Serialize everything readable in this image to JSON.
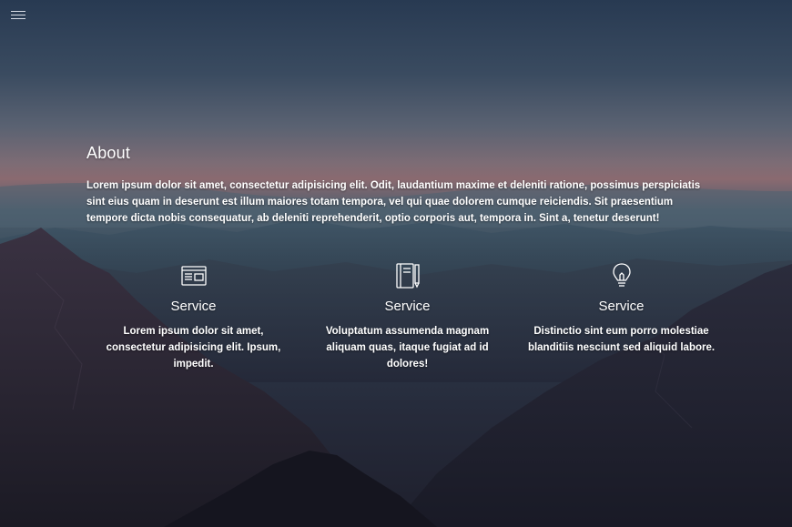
{
  "nav": {
    "menu_icon": "hamburger-menu-icon"
  },
  "about": {
    "title": "About",
    "text": "Lorem ipsum dolor sit amet, consectetur adipisicing elit. Odit, laudantium maxime et deleniti ratione, possimus perspiciatis sint eius quam in deserunt est illum maiores totam tempora, vel qui quae dolorem cumque reiciendis. Sit praesentium tempore dicta nobis consequatur, ab deleniti reprehenderit, optio corporis aut, tempora in. Sint a, tenetur deserunt!"
  },
  "services": [
    {
      "icon": "browser-window-icon",
      "title": "Service",
      "text": "Lorem ipsum dolor sit amet, consectetur adipisicing elit. Ipsum, impedit."
    },
    {
      "icon": "notebook-pencil-icon",
      "title": "Service",
      "text": "Voluptatum assumenda magnam aliquam quas, itaque fugiat ad id dolores!"
    },
    {
      "icon": "lightbulb-icon",
      "title": "Service",
      "text": "Distinctio sint eum porro molestiae blanditiis nesciunt sed aliquid labore."
    }
  ],
  "colors": {
    "text": "#ffffff",
    "sky_top": "#283a52",
    "horizon_glow": "#8a6a70",
    "mountains": "#1e1f2c"
  }
}
